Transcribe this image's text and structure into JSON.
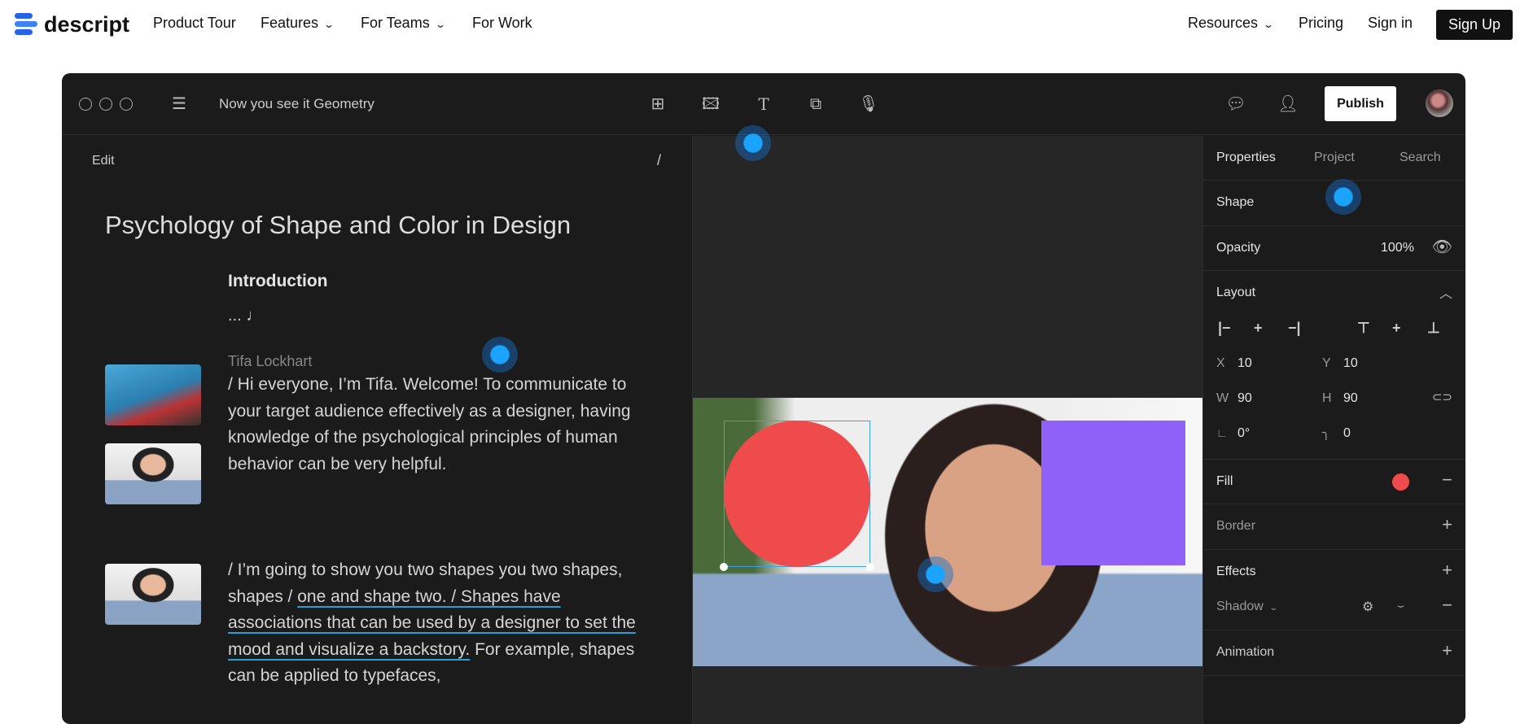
{
  "nav": {
    "brand": "descript",
    "links": [
      "Product Tour",
      "Features",
      "For Teams",
      "For Work"
    ],
    "right_links": [
      "Resources",
      "Pricing",
      "Sign in"
    ],
    "signup": "Sign Up",
    "chevron": "⌄"
  },
  "app": {
    "project_title": "Now you see it Geometry",
    "publish": "Publish",
    "editor": {
      "mode": "Edit",
      "slash": "/",
      "doc_title": "Psychology of Shape and Color in Design",
      "section": "Introduction",
      "music": "... ♩",
      "speaker": "Tifa Lockhart",
      "para1": "/ Hi everyone, I’m Tifa. Welcome! To communicate to your target audience effectively as a designer, having knowledge of the psychological principles of human behavior can be very helpful.",
      "para2_a": "/ I’m going to show you two shapes you two shapes, shapes / ",
      "para2_b": "one and shape two. / Shapes have associations that can be used by a designer to set the mood and visualize a backstory.",
      "para2_c": " For example, shapes can be applied to typefaces,"
    },
    "panel": {
      "tabs": [
        "Properties",
        "Project",
        "Search"
      ],
      "shape": "Shape",
      "opacity_label": "Opacity",
      "opacity": "100%",
      "layout": "Layout",
      "x_label": "X",
      "x": "10",
      "y_label": "Y",
      "y": "10",
      "w_label": "W",
      "w": "90",
      "h_label": "H",
      "h": "90",
      "rotation": "0°",
      "radius": "0",
      "fill": "Fill",
      "fill_color": "#f04b4c",
      "border": "Border",
      "effects": "Effects",
      "shadow": "Shadow",
      "animation": "Animation"
    },
    "shapes": {
      "circle_color": "#f04b4c",
      "square_color": "#9061f9"
    }
  }
}
